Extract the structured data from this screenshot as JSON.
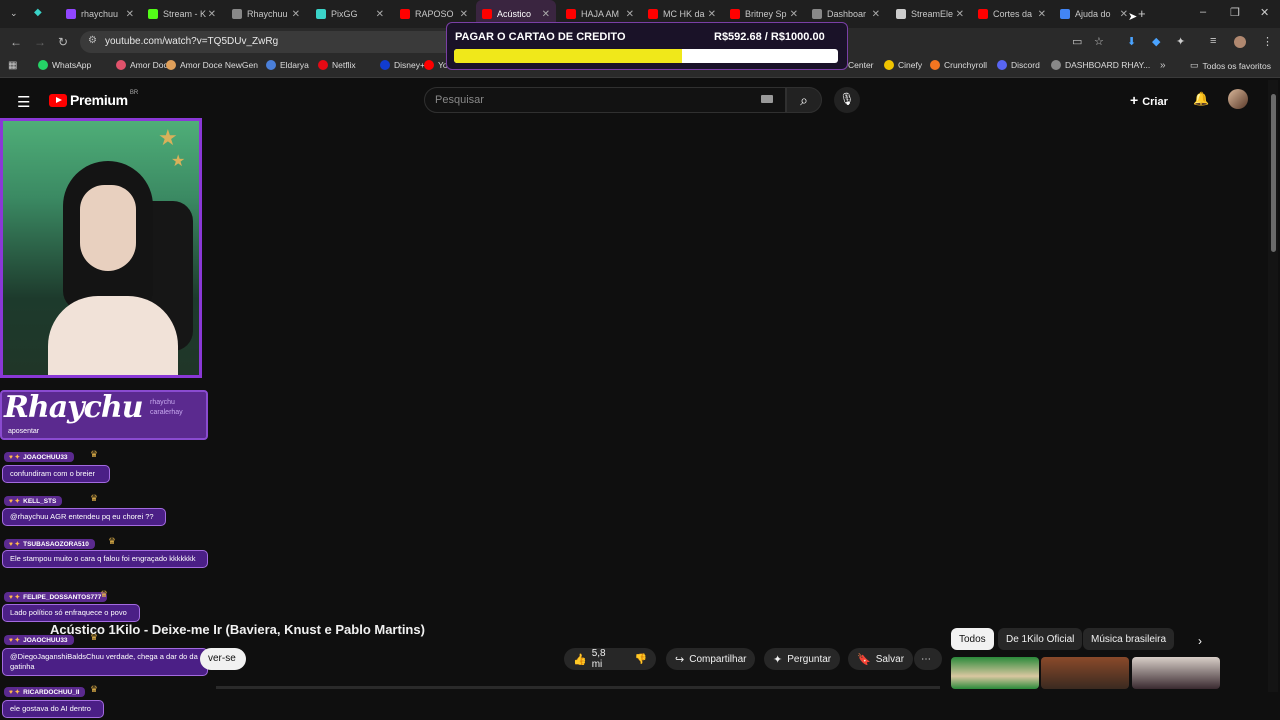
{
  "browser": {
    "tabs": [
      {
        "label": "rhaychuu",
        "icon": "twitch-icon",
        "color": "#9146ff"
      },
      {
        "label": "Stream - K",
        "icon": "kick-icon",
        "color": "#53fc18"
      },
      {
        "label": "Rhaychuu",
        "icon": "globe-icon",
        "color": "#888888"
      },
      {
        "label": "PixGG",
        "icon": "pixgg-icon",
        "color": "#3ad3c8"
      },
      {
        "label": "RAPOSO",
        "icon": "youtube-icon",
        "color": "#ff0000"
      },
      {
        "label": "Acústico",
        "icon": "youtube-icon",
        "color": "#ff0000"
      },
      {
        "label": "HAJA AM",
        "icon": "youtube-icon",
        "color": "#ff0000"
      },
      {
        "label": "MC HK da",
        "icon": "youtube-icon",
        "color": "#ff0000"
      },
      {
        "label": "Britney Sp",
        "icon": "youtube-icon",
        "color": "#ff0000"
      },
      {
        "label": "Dashboar",
        "icon": "globe-icon",
        "color": "#888888"
      },
      {
        "label": "StreamEle",
        "icon": "streamelements-icon",
        "color": "#cccccc"
      },
      {
        "label": "Cortes da",
        "icon": "youtube-icon",
        "color": "#ff0000"
      },
      {
        "label": "Ajuda do",
        "icon": "google-icon",
        "color": "#4285f4"
      }
    ],
    "active_tab": 5,
    "url": "youtube.com/watch?v=TQ5DUv_ZwRg",
    "bookmarks": [
      {
        "label": "WhatsApp",
        "color": "#25d366"
      },
      {
        "label": "Amor Doce",
        "color": "#e0526b"
      },
      {
        "label": "Amor Doce NewGen",
        "color": "#e0a05a"
      },
      {
        "label": "Eldarya",
        "color": "#4a7fd9"
      },
      {
        "label": "Netflix",
        "color": "#e50914"
      },
      {
        "label": "Disney+",
        "color": "#113ccf"
      },
      {
        "label": "Yo",
        "color": "#ff0000"
      },
      {
        "label": "Center",
        "color": ""
      },
      {
        "label": "Cinefy",
        "color": "#f0c400"
      },
      {
        "label": "Crunchyroll",
        "color": "#f47521"
      },
      {
        "label": "Discord",
        "color": "#5865f2"
      },
      {
        "label": "DASHBOARD RHAY...",
        "color": "#888888"
      }
    ],
    "all_bookmarks_label": "Todos os favoritos"
  },
  "youtube": {
    "logo_text": "Premium",
    "region": "BR",
    "search_placeholder": "Pesquisar",
    "create_label": "Criar",
    "video_title": "Acústico 1Kilo - Deixe-me Ir (Baviera, Knust e Pablo Martins)",
    "subscribe_label": "ver-se",
    "likes": "5,8 mi",
    "share_label": "Compartilhar",
    "ask_label": "Perguntar",
    "save_label": "Salvar",
    "chips": [
      "Todos",
      "De 1Kilo Oficial",
      "Música brasileira"
    ]
  },
  "overlay": {
    "goal_title": "PAGAR O CARTAO DE CREDITO",
    "goal_amount": "R$592.68 / R$1000.00",
    "goal_progress": 0.593
  },
  "stream": {
    "channel_logo": "Rhaychu",
    "channel_sub1": "rhaychu",
    "channel_sub2": "caralerhay",
    "first_message": "aposentar",
    "chat": [
      {
        "user": "JOAOCHUU33",
        "text": "confundiram com o breier"
      },
      {
        "user": "KELL_STS",
        "text": "@rhaychuu AGR entendeu pq eu chorei ??"
      },
      {
        "user": "TSUBASAOZORA510",
        "text": "Ele stampou muito o cara q falou foi engraçado kkkkkkk"
      },
      {
        "user": "FELIPE_DOSSANTOS777",
        "text": "Lado político só enfraquece o povo"
      },
      {
        "user": "JOAOCHUU33",
        "text": "@DiegoJaganshiBaldsChuu verdade, chega a dar do da gatinha"
      },
      {
        "user": "RICARDOCHUU_II",
        "text": "ele gostava do AI dentro"
      }
    ]
  }
}
